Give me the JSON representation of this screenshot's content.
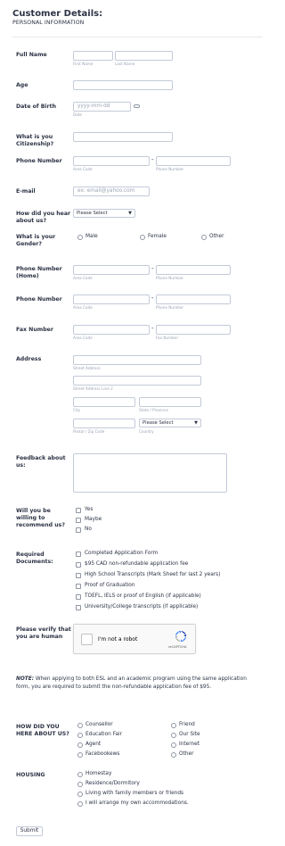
{
  "header": {
    "title": "Customer Details:",
    "subtitle": "PERSONAL INFORMATION"
  },
  "full_name": {
    "label": "Full Name",
    "first_sub": "First Name",
    "last_sub": "Last Name"
  },
  "age": {
    "label": "Age"
  },
  "dob": {
    "label": "Date of Birth",
    "placeholder": "yyyy-mm-dd",
    "sub": "Date"
  },
  "citizenship": {
    "label": "What is you Citizenship?"
  },
  "phone": {
    "label": "Phone Number",
    "area_sub": "Area Code",
    "number_sub": "Phone Number",
    "dash": "-"
  },
  "email": {
    "label": "E-mail",
    "placeholder": "ex: email@yahoo.com"
  },
  "heard": {
    "label": "How did you hear about us?",
    "selected": "Please Select"
  },
  "gender": {
    "label": "What is your Gender?",
    "options": [
      "Male",
      "Female",
      "Other"
    ]
  },
  "phone_home": {
    "label": "Phone Number (Home)",
    "area_sub": "Area Code",
    "number_sub": "Phone Number",
    "dash": "-"
  },
  "phone2": {
    "label": "Phone Number",
    "area_sub": "Area Code",
    "number_sub": "Phone Number",
    "dash": "-"
  },
  "fax": {
    "label": "Fax Number",
    "area_sub": "Area Code",
    "number_sub": "Fax Number",
    "dash": "-"
  },
  "address": {
    "label": "Address",
    "street_sub": "Street Address",
    "street2_sub": "Street Address Line 2",
    "city_sub": "City",
    "state_sub": "State / Province",
    "postal_sub": "Postal / Zip Code",
    "country_sub": "Country",
    "country_selected": "Please Select"
  },
  "feedback": {
    "label": "Feedback about us:"
  },
  "recommend": {
    "label": "Will you be willing to recommend us?",
    "options": [
      "Yes",
      "Maybe",
      "No"
    ]
  },
  "documents": {
    "label": "Required Documents:",
    "options": [
      "Completed Application Form",
      "$95 CAD non-refundable application fee",
      "High School Transcripts (Mark Sheet for last 2 years)",
      "Proof of Graduation",
      "TOEFL, IELS or proof of English (if applicable)",
      "University/College transcripts (if applicable)"
    ]
  },
  "captcha": {
    "label": "Please verify that you are human",
    "text": "I'm not a robot",
    "brand": "reCAPTCHA"
  },
  "note": {
    "bold": "NOTE:",
    "text": " When applying to both ESL and an academic program using the same application form, you are required to submit the non-refundable application fee of $95."
  },
  "how_heard": {
    "label": "HOW DID YOU HERE ABOUT US?",
    "left": [
      "Counsellor",
      "Education Fair",
      "Agent",
      "Facebookews"
    ],
    "right": [
      "Friend",
      "Our Site",
      "Internet",
      "Other"
    ]
  },
  "housing": {
    "label": "HOUSING",
    "options": [
      "Homestay",
      "Residence/Dormitory",
      "Living with family members or friends",
      "I will arrange my own accommodations."
    ]
  },
  "submit_label": "Submit"
}
